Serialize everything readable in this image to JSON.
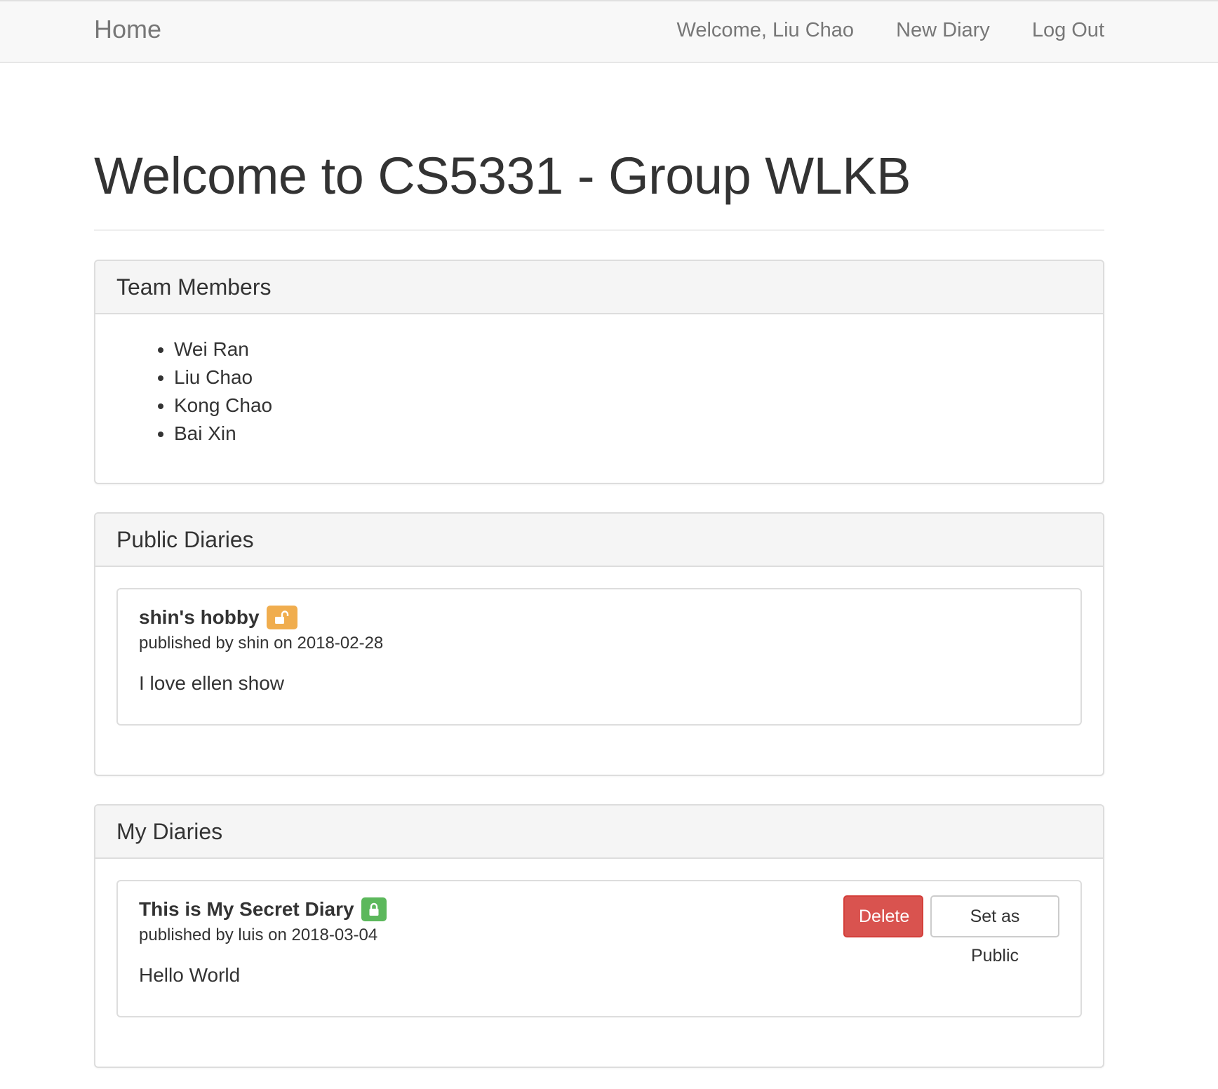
{
  "navbar": {
    "brand": "Home",
    "welcome": "Welcome, Liu Chao",
    "new_diary": "New Diary",
    "logout": "Log Out"
  },
  "page": {
    "title": "Welcome to CS5331 - Group WLKB"
  },
  "team_panel": {
    "heading": "Team Members",
    "members": [
      "Wei Ran",
      "Liu Chao",
      "Kong Chao",
      "Bai Xin"
    ]
  },
  "public_panel": {
    "heading": "Public Diaries",
    "diaries": [
      {
        "title": "shin's hobby",
        "meta": "published by shin on 2018-02-28",
        "content": "I love ellen show",
        "lock_icon": "unlock-icon",
        "badge_color": "#f0ad4e"
      }
    ]
  },
  "my_panel": {
    "heading": "My Diaries",
    "diaries": [
      {
        "title": "This is My Secret Diary",
        "meta": "published by luis on 2018-03-04",
        "content": "Hello World",
        "lock_icon": "lock-icon",
        "badge_color": "#5cb85c",
        "delete_label": "Delete",
        "set_public_label": "Set as Public"
      }
    ]
  },
  "colors": {
    "danger": "#d9534f",
    "warning": "#f0ad4e",
    "success": "#5cb85c",
    "navbar_bg": "#f8f8f8"
  }
}
